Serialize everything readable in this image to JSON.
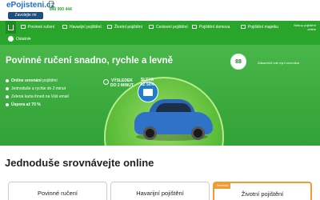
{
  "header": {
    "logo": "ePojisteni.cz",
    "hotline": "840 900 444",
    "callme_label": "Zavolejte mi"
  },
  "nav": {
    "items": [
      {
        "label": "Povinné ručení",
        "icon": "car-icon"
      },
      {
        "label": "Havarijní pojištění",
        "icon": "crash-car-icon"
      },
      {
        "label": "Životní pojištění",
        "icon": "heart-icon"
      },
      {
        "label": "Cestovní pojištění",
        "icon": "suitcase-icon"
      },
      {
        "label": "Pojištění domova",
        "icon": "house-icon"
      },
      {
        "label": "Pojištění majetku",
        "icon": "building-icon"
      }
    ],
    "right_link": "Nákup pojištění online"
  },
  "subbar": {
    "label": "Ostatní"
  },
  "hero": {
    "title": "Povinné ručení snadno, rychle a levně",
    "bullets": [
      {
        "strong": "Online srovnání",
        "rest": " pojištění"
      },
      {
        "strong": "",
        "rest": "Jednoduše a rychle do 2 minut"
      },
      {
        "strong": "",
        "rest": "Zelená karta ihned na Váš email"
      },
      {
        "strong": "Úspora až 70 %",
        "rest": ""
      }
    ],
    "badge_number": "88",
    "badge_text": "Zákazníků zde nyní srovnává",
    "result_label_line1": "VÝSLEDEK",
    "result_label_line2": "DO 2 MINUT",
    "discount_line1": "SLEVA",
    "discount_line2": "AŽ 50%"
  },
  "section": {
    "title": "Jednoduše srovnávejte online"
  },
  "tabs": [
    {
      "label": "Povinné ručení"
    },
    {
      "label": "Havarijní pojištění"
    },
    {
      "label": "Životní pojištění",
      "flag": "Novinka"
    }
  ],
  "colors": {
    "primary_green": "#2aa52c",
    "dark_green": "#1f8a22",
    "logo_blue": "#1a6fc4",
    "accent_orange": "#f09b35",
    "car_blue": "#2f72c7"
  }
}
